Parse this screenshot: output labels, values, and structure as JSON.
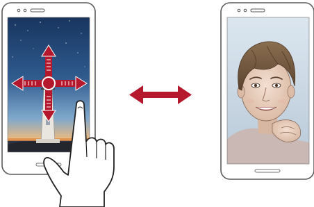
{
  "figure": {
    "left_phone": {
      "screen": "night-sky-lighthouse-photo",
      "overlay": "four-way-drag-arrows",
      "gesture": "pointing-hand"
    },
    "transition": "double-headed-arrow",
    "right_phone": {
      "screen": "front-camera-selfie-portrait"
    },
    "colors": {
      "accent": "#b5182c",
      "phone_outline": "#5a5a5a",
      "sky_top": "#1c3c6e",
      "sky_horizon": "#7fa8cc",
      "sunset": "#e79a4c"
    }
  }
}
